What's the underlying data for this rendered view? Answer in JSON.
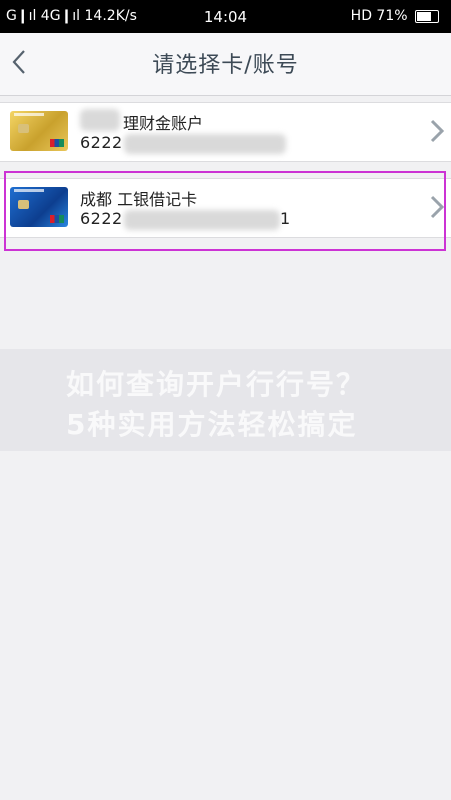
{
  "status_bar": {
    "left": "G❙ıl 4G❙ıl 14.2K/s",
    "time": "14:04",
    "right": "HD 71%"
  },
  "nav": {
    "title": "请选择卡/账号"
  },
  "accounts": [
    {
      "name": "理财金账户",
      "number": "6222",
      "card_color": "#e0bc48"
    },
    {
      "name": "成都 工银借记卡",
      "number": "6222",
      "number_tail": "1",
      "card_color": "#1a5cb8"
    }
  ],
  "selection_color": "#cc33d4",
  "watermark": {
    "line1": "如何查询开户行行号？",
    "line2": "5种实用方法轻松搞定"
  }
}
